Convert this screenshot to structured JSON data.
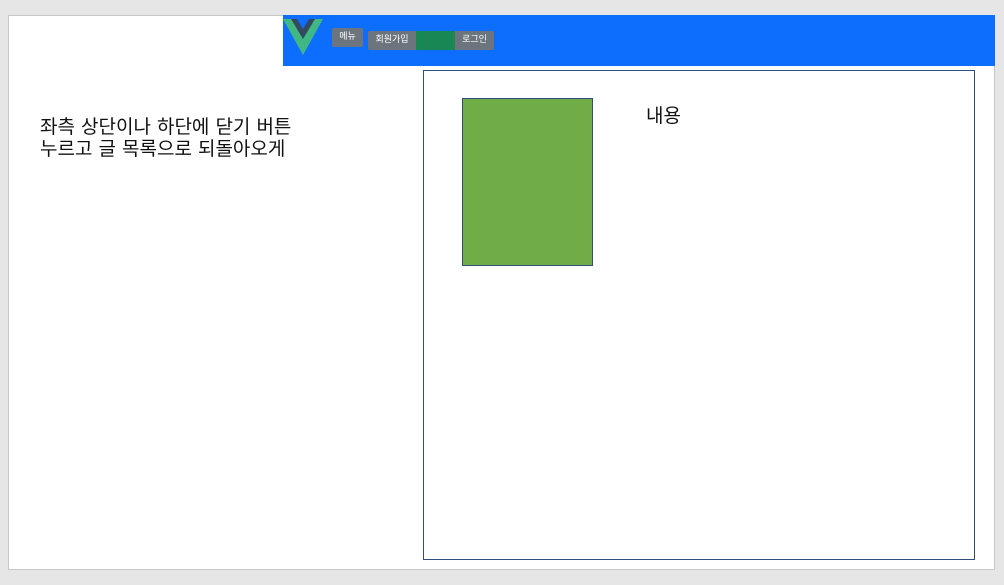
{
  "navbar": {
    "logo_icon": "vue-logo-icon",
    "accent_color": "#0d6efd",
    "menu_label": "메뉴",
    "signup_label": "회원가입",
    "middle_label": "",
    "login_label": "로그인"
  },
  "instruction": {
    "text": "좌측 상단이나 하단에 닫기 버튼 누르고 글 목록으로 되돌아오게"
  },
  "content": {
    "label": "내용"
  }
}
